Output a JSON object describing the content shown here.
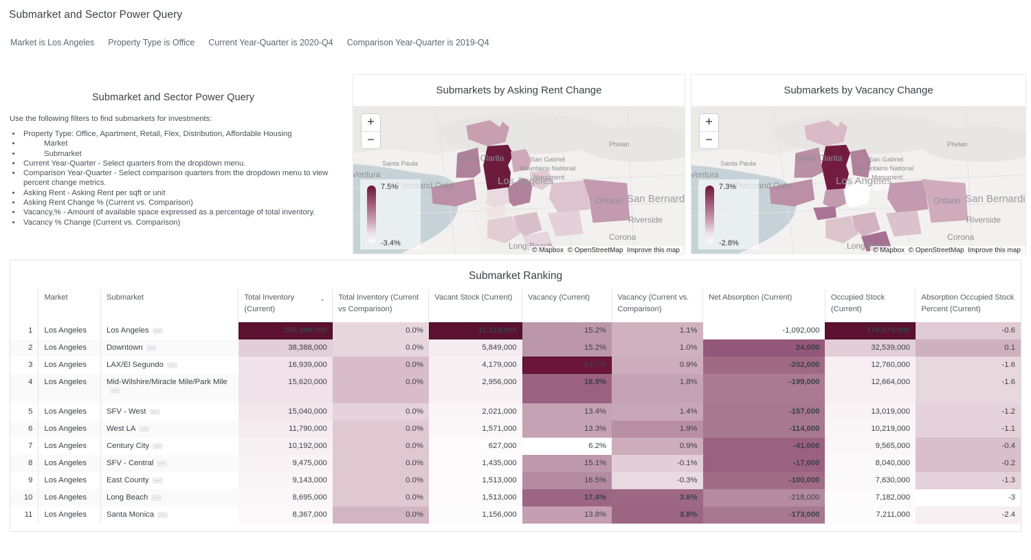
{
  "header": {
    "title": "Submarket and Sector Power Query",
    "filters": [
      "Market is Los Angeles",
      "Property Type is Office",
      "Current Year-Quarter is 2020-Q4",
      "Comparison Year-Quarter is 2019-Q4"
    ]
  },
  "description": {
    "title": "Submarket and Sector Power Query",
    "intro": "Use the following filters to find submarkets for investments:",
    "bullets": [
      "Property Type: Office, Apartment, Retail, Flex, Distribution, Affordable Housing",
      "Market",
      "Submarket",
      "Current Year-Quarter - Select quarters from the dropdown menu.",
      "Comparison Year-Quarter - Select comparison quarters from the dropdown menu to view percent change metrics.",
      "Asking Rent - Asking Rent per sqft or unit",
      "Asking Rent Change % (Current vs. Comparison)",
      "Vacancy,% - Amount of available space expressed as a percentage of total inventory.",
      "Vacancy % Change (Current vs. Comparison)"
    ]
  },
  "maps": [
    {
      "title": "Submarkets by Asking Rent Change",
      "zoom_in": "+",
      "zoom_out": "−",
      "legend_high": "7.5%",
      "legend_low": "-3.4%",
      "attribution": [
        "© Mapbox",
        "© OpenStreetMap",
        "Improve this map"
      ],
      "place_labels": [
        "Santa Paula",
        "Ventura",
        "Santa Clarita",
        "Thousand Oaks",
        "San Gabriel",
        "Mountains National",
        "Monument",
        "Phelan",
        "Los Angeles",
        "Ontario",
        "San Bernardi",
        "Riverside",
        "Corona",
        "Long Beach"
      ]
    },
    {
      "title": "Submarkets by Vacancy Change",
      "zoom_in": "+",
      "zoom_out": "−",
      "legend_high": "7.3%",
      "legend_low": "-2.8%",
      "attribution": [
        "© Mapbox",
        "© OpenStreetMap",
        "Improve this map"
      ],
      "place_labels": [
        "Santa Paula",
        "Ventura",
        "Santa Clarita",
        "Thousand Oaks",
        "San Gabriel",
        "Mountains National",
        "Monument",
        "Phelan",
        "Los Angeles",
        "Ontario",
        "San Bernardi",
        "Riverside",
        "Corona",
        "Long Beach"
      ]
    }
  ],
  "table": {
    "title": "Submarket Ranking",
    "sort_indicator": "⌄",
    "sorted_column": "Total Inventory (Current)",
    "row_ellipsis": "···",
    "columns": [
      {
        "label": "",
        "key": "index"
      },
      {
        "label": "Market",
        "key": "market"
      },
      {
        "label": "Submarket",
        "key": "submarket"
      },
      {
        "label": "Total Inventory (Current)",
        "key": "total_inventory_current"
      },
      {
        "label": "Total Inventory (Current vs Comparison)",
        "key": "total_inventory_change"
      },
      {
        "label": "Vacant Stock (Current)",
        "key": "vacant_stock_current"
      },
      {
        "label": "Vacancy (Current)",
        "key": "vacancy_current"
      },
      {
        "label": "Vacancy (Current vs. Comparison)",
        "key": "vacancy_change"
      },
      {
        "label": "Net Absorption (Current)",
        "key": "net_absorption_current"
      },
      {
        "label": "Occupied Stock (Current)",
        "key": "occupied_stock_current"
      },
      {
        "label": "Absorption Occupied Stock Percent (Current)",
        "key": "absorption_occupied_pct"
      }
    ],
    "rows": [
      {
        "index": "1",
        "market": "Los Angeles",
        "submarket": "Los Angeles",
        "total_inventory_current": "205,398,000",
        "total_inventory_change": "0.0%",
        "vacant_stock_current": "31,319,000",
        "vacancy_current": "15.2%",
        "vacancy_change": "1.1%",
        "net_absorption_current": "-1,092,000",
        "occupied_stock_current": "174,079,000",
        "absorption_occupied_pct": "-0.6"
      },
      {
        "index": "2",
        "market": "Los Angeles",
        "submarket": "Downtown",
        "total_inventory_current": "38,388,000",
        "total_inventory_change": "0.0%",
        "vacant_stock_current": "5,849,000",
        "vacancy_current": "15.2%",
        "vacancy_change": "1.0%",
        "net_absorption_current": "24,000",
        "occupied_stock_current": "32,539,000",
        "absorption_occupied_pct": "0.1"
      },
      {
        "index": "3",
        "market": "Los Angeles",
        "submarket": "LAX/El Segundo",
        "total_inventory_current": "16,939,000",
        "total_inventory_change": "0.0%",
        "vacant_stock_current": "4,179,000",
        "vacancy_current": "24.7%",
        "vacancy_change": "0.9%",
        "net_absorption_current": "-202,000",
        "occupied_stock_current": "12,760,000",
        "absorption_occupied_pct": "-1.6"
      },
      {
        "index": "4",
        "market": "Los Angeles",
        "submarket": "Mid-Wilshire/Miracle Mile/Park Mile",
        "total_inventory_current": "15,620,000",
        "total_inventory_change": "0.0%",
        "vacant_stock_current": "2,956,000",
        "vacancy_current": "18.9%",
        "vacancy_change": "1.8%",
        "net_absorption_current": "-199,000",
        "occupied_stock_current": "12,664,000",
        "absorption_occupied_pct": "-1.6"
      },
      {
        "index": "5",
        "market": "Los Angeles",
        "submarket": "SFV - West",
        "total_inventory_current": "15,040,000",
        "total_inventory_change": "0.0%",
        "vacant_stock_current": "2,021,000",
        "vacancy_current": "13.4%",
        "vacancy_change": "1.4%",
        "net_absorption_current": "-157,000",
        "occupied_stock_current": "13,019,000",
        "absorption_occupied_pct": "-1.2"
      },
      {
        "index": "6",
        "market": "Los Angeles",
        "submarket": "West LA",
        "total_inventory_current": "11,790,000",
        "total_inventory_change": "0.0%",
        "vacant_stock_current": "1,571,000",
        "vacancy_current": "13.3%",
        "vacancy_change": "1.9%",
        "net_absorption_current": "-114,000",
        "occupied_stock_current": "10,219,000",
        "absorption_occupied_pct": "-1.1"
      },
      {
        "index": "7",
        "market": "Los Angeles",
        "submarket": "Century City",
        "total_inventory_current": "10,192,000",
        "total_inventory_change": "0.0%",
        "vacant_stock_current": "627,000",
        "vacancy_current": "6.2%",
        "vacancy_change": "0.9%",
        "net_absorption_current": "-41,000",
        "occupied_stock_current": "9,565,000",
        "absorption_occupied_pct": "-0.4"
      },
      {
        "index": "8",
        "market": "Los Angeles",
        "submarket": "SFV - Central",
        "total_inventory_current": "9,475,000",
        "total_inventory_change": "0.0%",
        "vacant_stock_current": "1,435,000",
        "vacancy_current": "15.1%",
        "vacancy_change": "-0.1%",
        "net_absorption_current": "-17,000",
        "occupied_stock_current": "8,040,000",
        "absorption_occupied_pct": "-0.2"
      },
      {
        "index": "9",
        "market": "Los Angeles",
        "submarket": "East County",
        "total_inventory_current": "9,143,000",
        "total_inventory_change": "0.0%",
        "vacant_stock_current": "1,513,000",
        "vacancy_current": "16.5%",
        "vacancy_change": "-0.3%",
        "net_absorption_current": "-100,000",
        "occupied_stock_current": "7,630,000",
        "absorption_occupied_pct": "-1.3"
      },
      {
        "index": "10",
        "market": "Los Angeles",
        "submarket": "Long Beach",
        "total_inventory_current": "8,695,000",
        "total_inventory_change": "0.0%",
        "vacant_stock_current": "1,513,000",
        "vacancy_current": "17.4%",
        "vacancy_change": "3.6%",
        "net_absorption_current": "-218,000",
        "occupied_stock_current": "7,182,000",
        "absorption_occupied_pct": "-3"
      },
      {
        "index": "11",
        "market": "Los Angeles",
        "submarket": "Santa Monica",
        "total_inventory_current": "8,367,000",
        "total_inventory_change": "0.0%",
        "vacant_stock_current": "1,156,000",
        "vacancy_current": "13.8%",
        "vacancy_change": "3.8%",
        "net_absorption_current": "-173,000",
        "occupied_stock_current": "7,211,000",
        "absorption_occupied_pct": "-2.4"
      }
    ]
  },
  "colors": {
    "heat_max": "#5c1130",
    "heat_mid": "#a06a81",
    "heat_light": "#e6d4db",
    "heat_min": "#ffffff",
    "text_dark": "#3d4047",
    "text_muted": "#5a6570"
  }
}
